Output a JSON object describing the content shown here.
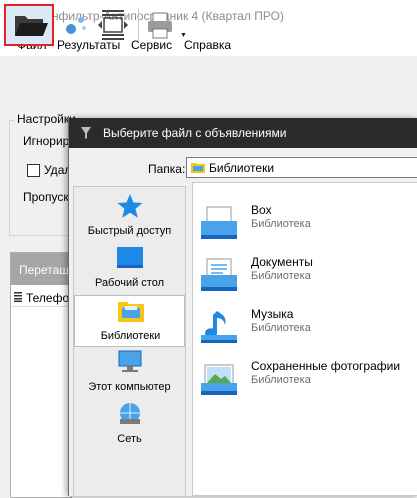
{
  "app": {
    "title": "Сканфильтр-Антипосредник 4 (Квартал ПРО)",
    "menu": [
      "Файл",
      "Результаты",
      "Сервис",
      "Справка"
    ],
    "settings": {
      "legend": "Настройки",
      "ignore_label": "Игнориро",
      "delete_label": "Удал",
      "delete_checked": false,
      "skip_label": "Пропуска"
    },
    "list": {
      "drag_hint": "Перетащ",
      "column_header": "Телефо"
    }
  },
  "dialog": {
    "title": "Выберите файл с объявлениями",
    "folder_label": "Папка:",
    "folder_value": "Библиотеки",
    "places": [
      {
        "label": "Быстрый доступ",
        "icon": "star-icon"
      },
      {
        "label": "Рабочий стол",
        "icon": "desktop-icon"
      },
      {
        "label": "Библиотеки",
        "icon": "libraries-icon",
        "selected": true
      },
      {
        "label": "Этот компьютер",
        "icon": "computer-icon"
      },
      {
        "label": "Сеть",
        "icon": "network-icon"
      }
    ],
    "libraries": [
      {
        "name": "Box",
        "type": "Библиотека",
        "icon": "box-library-icon"
      },
      {
        "name": "Документы",
        "type": "Библиотека",
        "icon": "documents-library-icon"
      },
      {
        "name": "Музыка",
        "type": "Библиотека",
        "icon": "music-library-icon"
      },
      {
        "name": "Сохраненные фотографии",
        "type": "Библиотека",
        "icon": "pictures-library-icon"
      }
    ]
  },
  "colors": {
    "highlight": "#e5202a",
    "dialog_title_bg": "#2b2b2b",
    "accent": "#1e88e5"
  }
}
